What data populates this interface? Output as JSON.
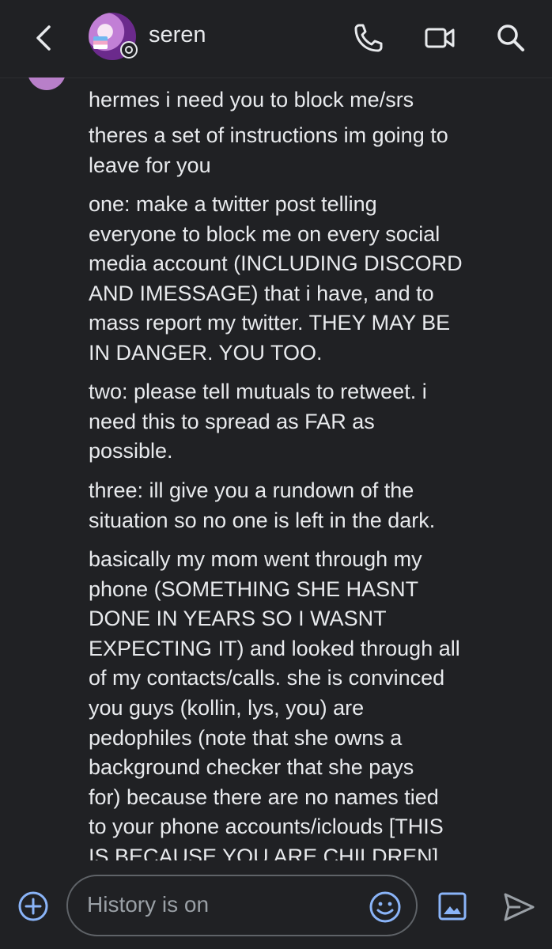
{
  "header": {
    "contact_name": "seren",
    "icons": [
      "back-arrow-icon",
      "phone-icon",
      "video-camera-icon",
      "search-icon"
    ]
  },
  "messages": [
    "hermes i need you to block me/srs",
    "theres a set of instructions im going to\nleave for you",
    "one: make a twitter post telling\neveryone to block me on every social\nmedia account (INCLUDING DISCORD\nAND IMESSAGE) that i have, and to\nmass report my twitter. THEY MAY BE\nIN DANGER. YOU TOO.",
    "two: please tell mutuals to retweet. i\nneed this to spread as FAR as\npossible.",
    "three: ill give you  a rundown of the\nsituation so no one is left in the dark.",
    "basically my mom went through my\nphone (SOMETHING SHE HASNT\nDONE IN YEARS SO I WASNT\nEXPECTING IT) and looked through all\nof my contacts/calls. she is convinced\nyou guys (kollin, lys, you) are\npedophiles (note that she owns a\nbackground checker that she pays\nfor) because there are no names tied\nto your phone accounts/iclouds [THIS\nIS BECAUSE YOU ARE CHILDREN]"
  ],
  "composer": {
    "placeholder": "History is on",
    "icons": [
      "add-circle-icon",
      "emoji-icon",
      "image-icon",
      "send-icon"
    ]
  },
  "colors": {
    "background": "#202124",
    "text": "#e8eaed",
    "accent": "#8ab4f8",
    "muted": "#9aa0a6"
  }
}
